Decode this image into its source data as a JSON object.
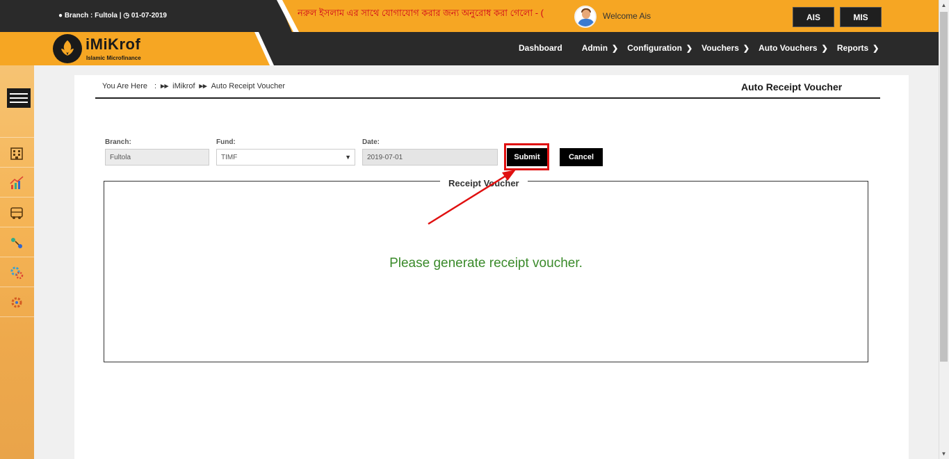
{
  "topbar": {
    "branch_info": "Branch : Fultola |",
    "date_info": "01-07-2019",
    "marquee_text": "নরুল ইসলাম এর সাথে যোগাযোগ করার জন্য অনুরোধ করা গেলো - (",
    "welcome": "Welcome Ais",
    "btn_ais": "AIS",
    "btn_mis": "MIS"
  },
  "logo": {
    "title": "iMiKrof",
    "subtitle": "Islamic Microfinance"
  },
  "nav": {
    "dashboard": "Dashboard",
    "admin": "Admin",
    "configuration": "Configuration",
    "vouchers": "Vouchers",
    "auto_vouchers": "Auto Vouchers",
    "reports": "Reports"
  },
  "breadcrumb": {
    "label": "You Are Here",
    "sep": ":",
    "item1": "iMikrof",
    "item2": "Auto Receipt Voucher"
  },
  "page": {
    "title": "Auto Receipt Voucher"
  },
  "form": {
    "branch_label": "Branch:",
    "branch_value": "Fultola",
    "fund_label": "Fund:",
    "fund_value": "TIMF",
    "date_label": "Date:",
    "date_value": "2019-07-01",
    "submit_label": "Submit",
    "cancel_label": "Cancel"
  },
  "voucher": {
    "legend": "Receipt Voucher",
    "message": "Please generate receipt voucher."
  },
  "colors": {
    "accent": "#f6a623",
    "dark": "#2a2a2a",
    "highlight": "#e01010",
    "message": "#3a8a2a"
  },
  "icons": [
    "building-icon",
    "chart-icon",
    "bus-icon",
    "map-icon",
    "gear-group-icon",
    "settings-icon"
  ]
}
